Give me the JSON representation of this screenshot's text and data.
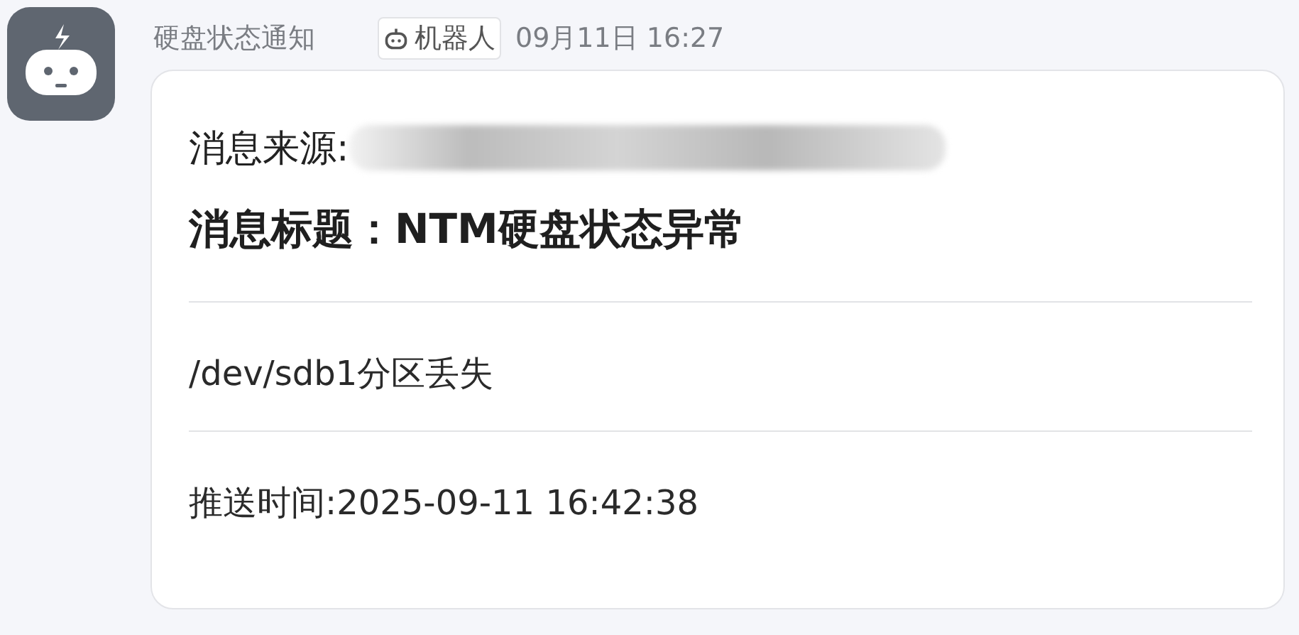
{
  "sender": {
    "name": "硬盘状态通知",
    "badge": "机器人",
    "time": "09月11日 16:27"
  },
  "message": {
    "source_label": "消息来源:",
    "title": "消息标题：NTM硬盘状态异常",
    "body": "/dev/sdb1分区丢失",
    "push_time": "推送时间:2025-09-11 16:42:38"
  }
}
